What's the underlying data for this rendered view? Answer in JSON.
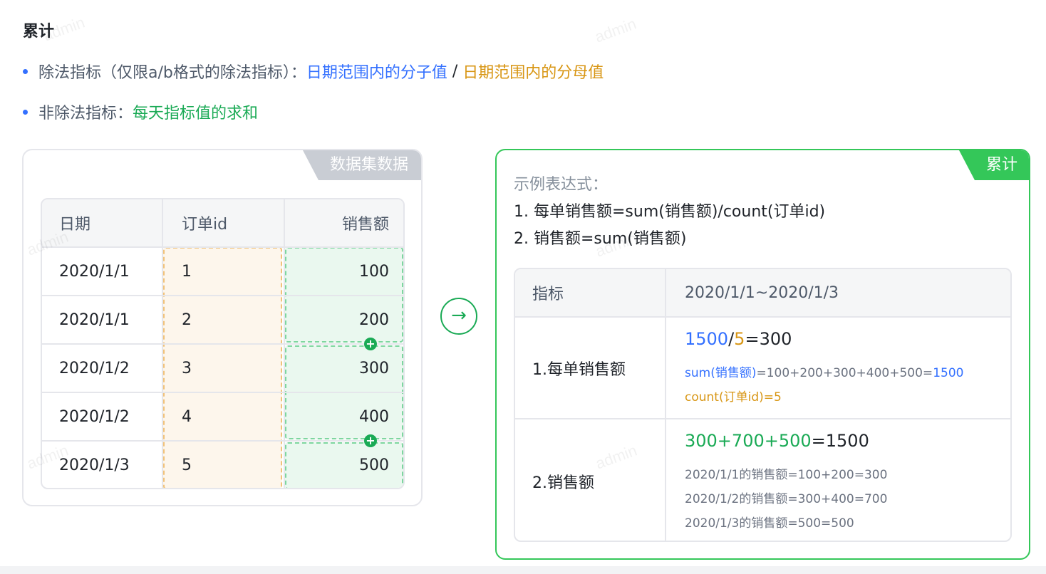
{
  "heading": "累计",
  "bullets": {
    "divide": {
      "label": "除法指标（仅限a/b格式的除法指标）：",
      "numerator": "日期范围内的分子值",
      "slash": " / ",
      "denominator": "日期范围内的分母值"
    },
    "non_divide": {
      "label": "非除法指标：",
      "value": "每天指标值的求和"
    }
  },
  "watermark": "admin",
  "left_card": {
    "tag": "数据集数据",
    "table": {
      "headers": [
        "日期",
        "订单id",
        "销售额"
      ],
      "rows": [
        [
          "2020/1/1",
          "1",
          "100"
        ],
        [
          "2020/1/1",
          "2",
          "200"
        ],
        [
          "2020/1/2",
          "3",
          "300"
        ],
        [
          "2020/1/2",
          "4",
          "400"
        ],
        [
          "2020/1/3",
          "5",
          "500"
        ]
      ]
    },
    "plus_symbol": "+"
  },
  "arrow": "→",
  "right_card": {
    "tag": "累计",
    "expr_label": "示例表达式：",
    "expr_lines": [
      "1. 每单销售额=sum(销售额)/count(订单id)",
      "2. 销售额=sum(销售额)"
    ],
    "table": {
      "header_metric": "指标",
      "header_range": "2020/1/1~2020/1/3",
      "row1": {
        "metric": "1.每单销售额",
        "result_num": "1500",
        "result_slash": "/",
        "result_den": "5",
        "result_eq": "=300",
        "detail1_a": "sum(销售额)",
        "detail1_b": "=100+200+300+400+500=",
        "detail1_c": "1500",
        "detail2_a": "count(订单id)=",
        "detail2_b": "5"
      },
      "row2": {
        "metric": "2.销售额",
        "result_sum": "300+700+500",
        "result_eq": "=1500",
        "details": [
          "2020/1/1的销售额=100+200=300",
          "2020/1/2的销售额=300+400=700",
          "2020/1/3的销售额=500=500"
        ]
      }
    }
  },
  "colors": {
    "blue": "#3370ff",
    "orange": "#d89614",
    "green": "#1aaa55",
    "tag_gray": "#c9cdd4",
    "tag_green": "#34c759"
  }
}
